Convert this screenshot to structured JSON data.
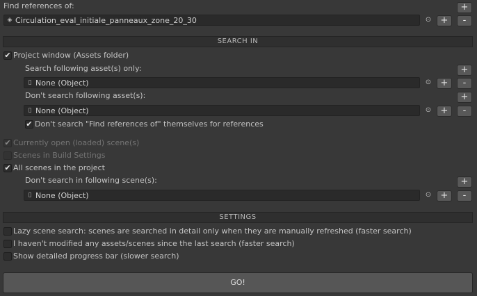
{
  "find_refs": {
    "label": "Find references of:",
    "asset_value": "Circulation_eval_initiale_panneaux_zone_20_30",
    "asset_icon": "scene-asset-icon",
    "picker_icon": "object-picker-icon",
    "add_label": "+",
    "plus_label": "+",
    "minus_label": "-"
  },
  "search_in": {
    "header": "SEARCH IN",
    "project_window": {
      "label": "Project window (Assets folder)",
      "checked": "✔",
      "search_only_label": "Search following asset(s) only:",
      "search_only_value": "None (Object)",
      "dont_search_label": "Don't search following asset(s):",
      "dont_search_value": "None (Object)",
      "dont_search_self_label": "Don't search \"Find references of\" themselves for references",
      "dont_search_self_checked": "✔"
    },
    "open_scenes": {
      "label": "Currently open (loaded) scene(s)",
      "checked": "✔"
    },
    "build_scenes": {
      "label": "Scenes in Build Settings",
      "checked": ""
    },
    "all_scenes": {
      "label": "All scenes in the project",
      "checked": "✔",
      "dont_search_label": "Don't search in following scene(s):",
      "dont_search_value": "None (Object)"
    }
  },
  "settings": {
    "header": "SETTINGS",
    "lazy": {
      "label": "Lazy scene search: scenes are searched in detail only when they are manually refreshed (faster search)",
      "checked": ""
    },
    "not_modified": {
      "label": "I haven't modified any assets/scenes since the last search (faster search)",
      "checked": ""
    },
    "progress_bar": {
      "label": "Show detailed progress bar (slower search)",
      "checked": ""
    }
  },
  "go_label": "GO!",
  "glyphs": {
    "picker": "⊙",
    "object": "▯",
    "scene": "◈"
  }
}
